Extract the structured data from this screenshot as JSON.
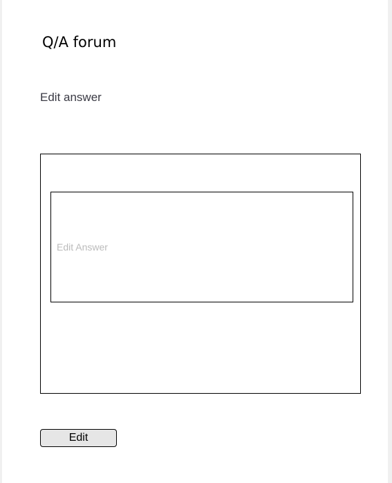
{
  "header": {
    "title": "Q/A forum"
  },
  "form": {
    "heading": "Edit answer",
    "answer_value": "",
    "answer_placeholder": "Edit Answer",
    "submit_label": "Edit"
  }
}
